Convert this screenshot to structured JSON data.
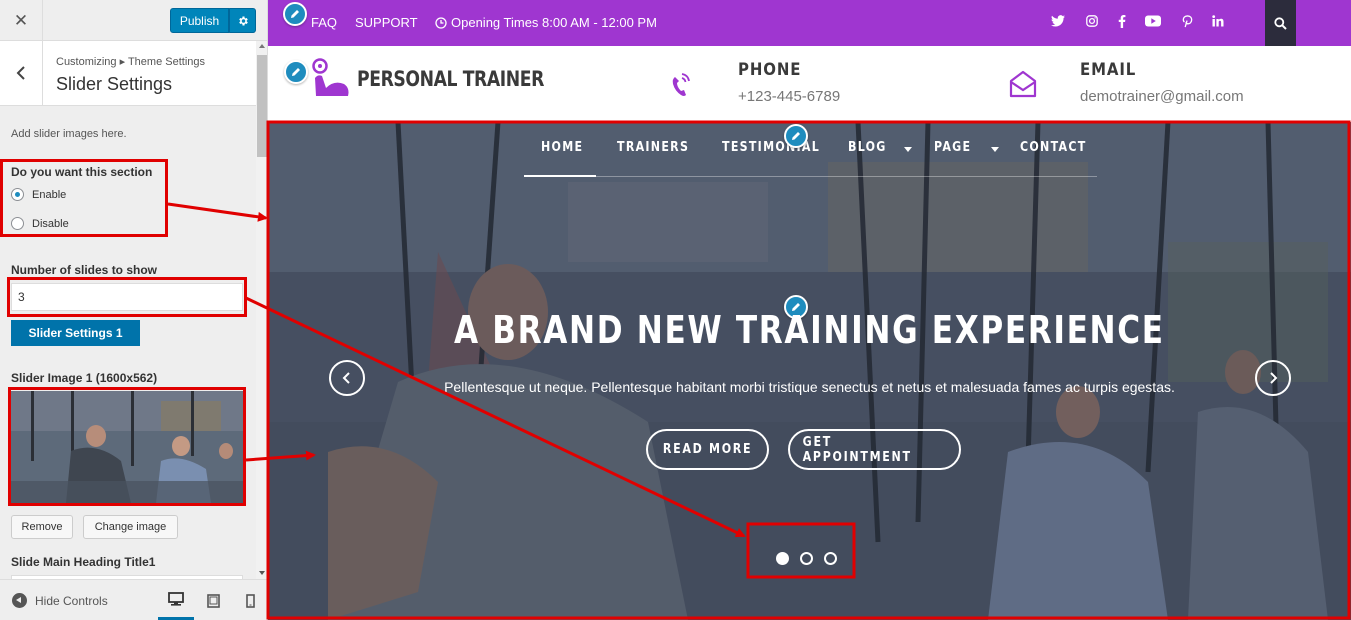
{
  "customizer": {
    "close_icon": "close-icon",
    "publish_label": "Publish",
    "breadcrumb": "Customizing ▸ Theme Settings",
    "section_title": "Slider Settings",
    "description": "Add slider images here.",
    "section_toggle_label": "Do you want this section",
    "radio_options": [
      {
        "label": "Enable",
        "checked": true
      },
      {
        "label": "Disable",
        "checked": false
      }
    ],
    "slides_label": "Number of slides to show",
    "slides_value": "3",
    "slider_settings_button": "Slider Settings 1",
    "image_label": "Slider Image 1 (1600x562)",
    "remove_label": "Remove",
    "change_image_label": "Change image",
    "heading_title_label": "Slide Main Heading Title1",
    "hide_controls_label": "Hide Controls",
    "preview_devices": [
      "desktop",
      "tablet",
      "mobile"
    ],
    "active_device": "desktop"
  },
  "site": {
    "topbar": {
      "faq": "FAQ",
      "support": "SUPPORT",
      "opening_times": "Opening Times 8:00 AM - 12:00 PM",
      "social_icons": [
        "twitter-icon",
        "instagram-icon",
        "facebook-icon",
        "youtube-icon",
        "pinterest-icon",
        "linkedin-icon"
      ],
      "background": "#9f36d0"
    },
    "header": {
      "logo_text": "PERSONAL TRAINER",
      "phone_title": "PHONE",
      "phone_value": "+123-445-6789",
      "email_title": "EMAIL",
      "email_value": "demotrainer@gmail.com"
    },
    "nav": [
      {
        "label": "HOME",
        "active": true
      },
      {
        "label": "TRAINERS"
      },
      {
        "label": "TESTIMONIAL"
      },
      {
        "label": "BLOG",
        "dropdown": true
      },
      {
        "label": "PAGE",
        "dropdown": true
      },
      {
        "label": "CONTACT"
      }
    ],
    "slider": {
      "heading": "A BRAND NEW TRAINING EXPERIENCE",
      "text": "Pellentesque ut neque. Pellentesque habitant morbi tristique senectus et netus et malesuada fames ac turpis egestas.",
      "read_more": "READ MORE",
      "appointment": "GET APPOINTMENT",
      "slide_count": 3,
      "active_slide": 1
    }
  },
  "colors": {
    "accent_purple": "#9f36d0",
    "wp_blue": "#0073aa",
    "annotation_red": "#e00000"
  }
}
